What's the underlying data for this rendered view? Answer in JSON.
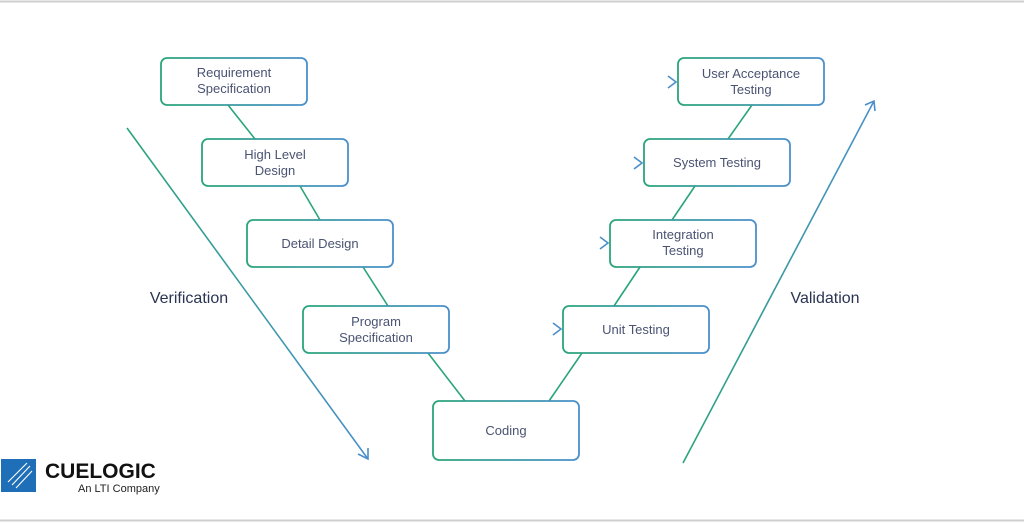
{
  "colors": {
    "green": "#2aa57a",
    "blue": "#4a8fcb",
    "text": "#4a5372"
  },
  "left": {
    "requirement": [
      "Requirement",
      "Specification"
    ],
    "high_level": [
      "High Level",
      "Design"
    ],
    "detail": [
      "Detail Design"
    ],
    "program": [
      "Program",
      "Specification"
    ]
  },
  "bottom": {
    "coding": [
      "Coding"
    ]
  },
  "right": {
    "unit": [
      "Unit Testing"
    ],
    "integration": [
      "Integration",
      "Testing"
    ],
    "system": [
      "System Testing"
    ],
    "uat": [
      "User Acceptance",
      "Testing"
    ]
  },
  "labels": {
    "verification": "Verification",
    "validation": "Validation"
  },
  "logo": {
    "name": "CUELOGIC",
    "tagline": "An LTI Company"
  }
}
